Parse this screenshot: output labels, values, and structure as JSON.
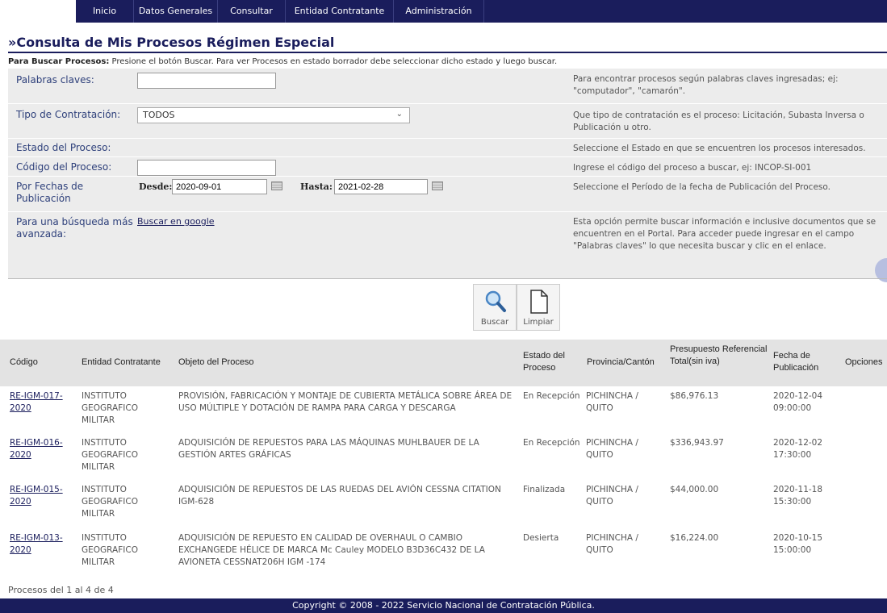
{
  "nav": {
    "items": [
      "Inicio",
      "Datos Generales",
      "Consultar",
      "Entidad Contratante",
      "Administración"
    ]
  },
  "page": {
    "title": "»Consulta de Mis Procesos Régimen Especial",
    "instructions_bold": "Para Buscar Procesos:",
    "instructions_text": " Presione el botón Buscar. Para ver Procesos en estado borrador debe seleccionar dicho estado y luego buscar."
  },
  "form": {
    "keywords": {
      "label": "Palabras claves:",
      "value": "",
      "help": "Para encontrar procesos según palabras claves ingresadas; ej: \"computador\", \"camarón\"."
    },
    "contract_type": {
      "label": "Tipo de Contratación:",
      "selected": "TODOS",
      "help": "Que tipo de contratación es el proceso: Licitación, Subasta Inversa o Publicación u otro."
    },
    "process_state": {
      "label": "Estado del Proceso:",
      "help": "Seleccione el Estado en que se encuentren los procesos interesados."
    },
    "process_code": {
      "label": "Código del Proceso:",
      "value": "",
      "help": "Ingrese el código del proceso a buscar, ej: INCOP-SI-001"
    },
    "dates": {
      "label": "Por Fechas de Publicación",
      "from_label": "Desde:",
      "from_value": "2020-09-01",
      "to_label": "Hasta:",
      "to_value": "2021-02-28",
      "help": "Seleccione el Período de la fecha de Publicación del Proceso."
    },
    "advanced": {
      "label": "Para una búsqueda más avanzada:",
      "link": "Buscar en google",
      "help": "Esta opción permite buscar información e inclusive documentos que se encuentren en el Portal. Para acceder puede ingresar en el campo \"Palabras claves\" lo que necesita buscar y clic en el enlace."
    }
  },
  "buttons": {
    "search": "Buscar",
    "clear": "Limpiar"
  },
  "table": {
    "headers": {
      "code": "Código",
      "entity": "Entidad Contratante",
      "object": "Objeto del Proceso",
      "state": "Estado del Proceso",
      "location": "Provincia/Cantón",
      "budget": "Presupuesto Referencial Total(sin iva)",
      "date": "Fecha de Publicación",
      "options": "Opciones"
    },
    "rows": [
      {
        "code": "RE-IGM-017-2020",
        "entity": "INSTITUTO GEOGRAFICO MILITAR",
        "object": "PROVISIÓN, FABRICACIÓN Y MONTAJE DE CUBIERTA METÁLICA SOBRE ÁREA DE USO MÚLTIPLE Y DOTACIÓN DE RAMPA PARA CARGA Y DESCARGA",
        "state": "En Recepción",
        "location": "PICHINCHA / QUITO",
        "budget": "$86,976.13",
        "date": "2020-12-04 09:00:00"
      },
      {
        "code": "RE-IGM-016-2020",
        "entity": "INSTITUTO GEOGRAFICO MILITAR",
        "object": "ADQUISICIÓN DE REPUESTOS PARA LAS MÁQUINAS MUHLBAUER DE LA GESTIÓN ARTES GRÁFICAS",
        "state": "En Recepción",
        "location": "PICHINCHA / QUITO",
        "budget": "$336,943.97",
        "date": "2020-12-02 17:30:00"
      },
      {
        "code": "RE-IGM-015-2020",
        "entity": "INSTITUTO GEOGRAFICO MILITAR",
        "object": "ADQUISICIÓN DE REPUESTOS DE LAS RUEDAS DEL AVIÓN CESSNA CITATION IGM-628",
        "state": "Finalizada",
        "location": "PICHINCHA / QUITO",
        "budget": "$44,000.00",
        "date": "2020-11-18 15:30:00"
      },
      {
        "code": "RE-IGM-013-2020",
        "entity": "INSTITUTO GEOGRAFICO MILITAR",
        "object": "ADQUISICIÓN DE REPUESTO EN CALIDAD DE OVERHAUL O CAMBIO EXCHANGEDE HÉLICE DE MARCA Mc Cauley MODELO B3D36C432 DE LA AVIONETA CESSNAT206H IGM -174",
        "state": "Desierta",
        "location": "PICHINCHA / QUITO",
        "budget": "$16,224.00",
        "date": "2020-10-15 15:00:00"
      }
    ]
  },
  "pager": "Procesos del 1 al 4 de 4",
  "footer": "Copyright © 2008 - 2022 Servicio Nacional de Contratación Pública."
}
